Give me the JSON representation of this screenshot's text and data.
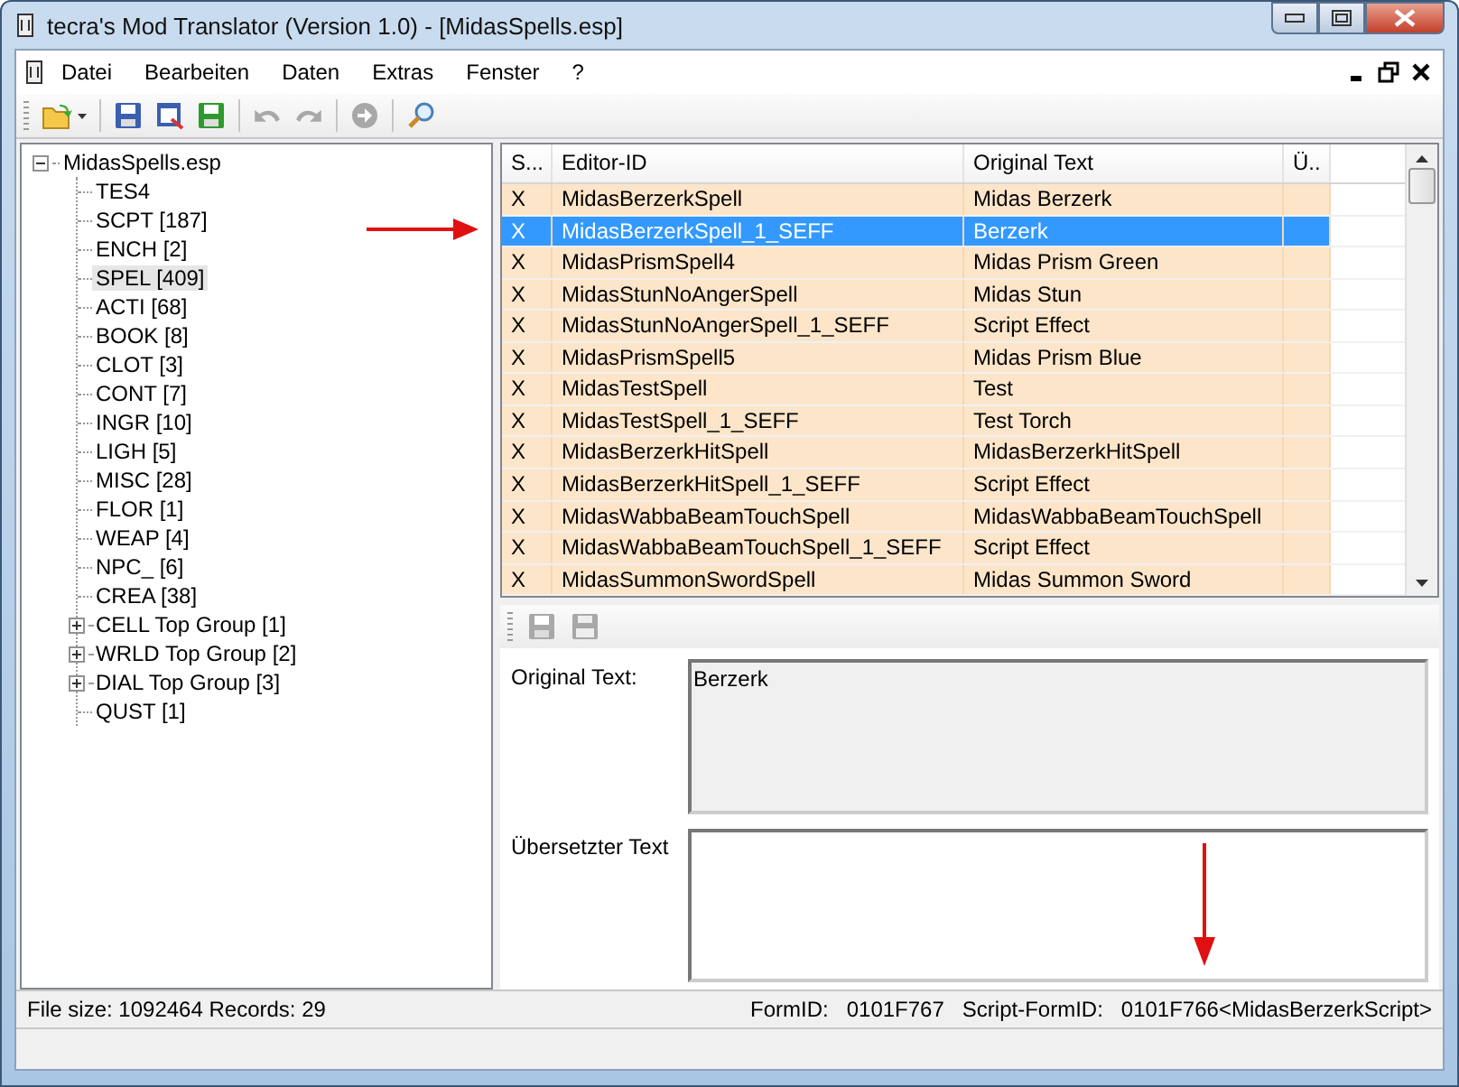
{
  "window": {
    "title": "tecra's Mod Translator (Version 1.0) - [MidasSpells.esp]"
  },
  "menu": [
    "Datei",
    "Bearbeiten",
    "Daten",
    "Extras",
    "Fenster",
    "?"
  ],
  "toolbar": [
    {
      "kind": "open",
      "disabled": false
    },
    {
      "kind": "save",
      "disabled": false
    },
    {
      "kind": "save-preview",
      "disabled": false
    },
    {
      "kind": "save-green",
      "disabled": false
    },
    {
      "kind": "undo",
      "disabled": true
    },
    {
      "kind": "redo",
      "disabled": true
    },
    {
      "kind": "go",
      "disabled": true
    },
    {
      "kind": "search",
      "disabled": false
    }
  ],
  "tree": {
    "label": "MidasSpells.esp",
    "expanded": true,
    "children": [
      {
        "label": "TES4",
        "kind": "leaf",
        "selected": false
      },
      {
        "label": "SCPT [187]",
        "kind": "leaf",
        "selected": false
      },
      {
        "label": "ENCH [2]",
        "kind": "leaf",
        "selected": false
      },
      {
        "label": "SPEL [409]",
        "kind": "leaf",
        "selected": true
      },
      {
        "label": "ACTI [68]",
        "kind": "leaf",
        "selected": false
      },
      {
        "label": "BOOK [8]",
        "kind": "leaf",
        "selected": false
      },
      {
        "label": "CLOT [3]",
        "kind": "leaf",
        "selected": false
      },
      {
        "label": "CONT [7]",
        "kind": "leaf",
        "selected": false
      },
      {
        "label": "INGR [10]",
        "kind": "leaf",
        "selected": false
      },
      {
        "label": "LIGH [5]",
        "kind": "leaf",
        "selected": false
      },
      {
        "label": "MISC [28]",
        "kind": "leaf",
        "selected": false
      },
      {
        "label": "FLOR [1]",
        "kind": "leaf",
        "selected": false
      },
      {
        "label": "WEAP [4]",
        "kind": "leaf",
        "selected": false
      },
      {
        "label": "NPC_ [6]",
        "kind": "leaf",
        "selected": false
      },
      {
        "label": "CREA [38]",
        "kind": "leaf",
        "selected": false
      },
      {
        "label": "CELL Top Group [1]",
        "kind": "group",
        "expanded": false,
        "selected": false
      },
      {
        "label": "WRLD Top Group [2]",
        "kind": "group",
        "expanded": false,
        "selected": false
      },
      {
        "label": "DIAL Top Group [3]",
        "kind": "group",
        "expanded": false,
        "selected": false
      },
      {
        "label": "QUST [1]",
        "kind": "leaf",
        "selected": false
      }
    ]
  },
  "table": {
    "columns": [
      "S...",
      "Editor-ID",
      "Original Text",
      "Ü.."
    ],
    "rows": [
      {
        "column_1": "X",
        "editor_id": "MidasBerzerkSpell",
        "original_text": "Midas Berzerk",
        "selected": false
      },
      {
        "column_1": "X",
        "editor_id": "MidasBerzerkSpell_1_SEFF",
        "original_text": "Berzerk",
        "selected": true
      },
      {
        "column_1": "X",
        "editor_id": "MidasPrismSpell4",
        "original_text": "Midas Prism Green",
        "selected": false
      },
      {
        "column_1": "X",
        "editor_id": "MidasStunNoAngerSpell",
        "original_text": "Midas Stun",
        "selected": false
      },
      {
        "column_1": "X",
        "editor_id": "MidasStunNoAngerSpell_1_SEFF",
        "original_text": "Script Effect",
        "selected": false
      },
      {
        "column_1": "X",
        "editor_id": "MidasPrismSpell5",
        "original_text": "Midas Prism Blue",
        "selected": false
      },
      {
        "column_1": "X",
        "editor_id": "MidasTestSpell",
        "original_text": "Test",
        "selected": false
      },
      {
        "column_1": "X",
        "editor_id": "MidasTestSpell_1_SEFF",
        "original_text": "Test Torch",
        "selected": false
      },
      {
        "column_1": "X",
        "editor_id": "MidasBerzerkHitSpell",
        "original_text": "MidasBerzerkHitSpell",
        "selected": false
      },
      {
        "column_1": "X",
        "editor_id": "MidasBerzerkHitSpell_1_SEFF",
        "original_text": "Script Effect",
        "selected": false
      },
      {
        "column_1": "X",
        "editor_id": "MidasWabbaBeamTouchSpell",
        "original_text": "MidasWabbaBeamTouchSpell",
        "selected": false
      },
      {
        "column_1": "X",
        "editor_id": "MidasWabbaBeamTouchSpell_1_SEFF",
        "original_text": "Script Effect",
        "selected": false
      },
      {
        "column_1": "X",
        "editor_id": "MidasSummonSwordSpell",
        "original_text": "Midas Summon Sword",
        "selected": false
      }
    ]
  },
  "editor_toolbar": [
    {
      "kind": "save",
      "disabled": true
    },
    {
      "kind": "save-all",
      "disabled": true
    }
  ],
  "details": {
    "original_label": "Original Text:",
    "original_value": "Berzerk",
    "translated_label": "Übersetzter Text"
  },
  "status_bar": {
    "file_info": "File size: 1092464 Records: 29",
    "form_id_label": "FormID:",
    "form_id": "0101F767",
    "script_form_id_label": "Script-FormID:",
    "script_form_id": "0101F766<MidasBerzerkScript>"
  }
}
